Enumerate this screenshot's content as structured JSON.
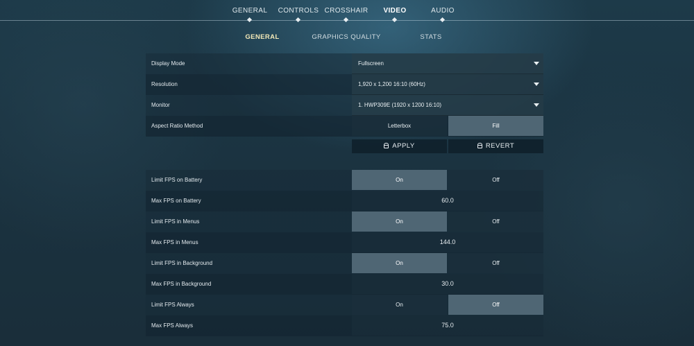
{
  "top_tabs": [
    {
      "label": "GENERAL",
      "active": false
    },
    {
      "label": "CONTROLS",
      "active": false
    },
    {
      "label": "CROSSHAIR",
      "active": false
    },
    {
      "label": "VIDEO",
      "active": true
    },
    {
      "label": "AUDIO",
      "active": false
    }
  ],
  "sub_tabs": [
    {
      "label": "GENERAL",
      "active": true
    },
    {
      "label": "GRAPHICS QUALITY",
      "active": false
    },
    {
      "label": "STATS",
      "active": false
    }
  ],
  "settings": {
    "display_mode": {
      "label": "Display Mode",
      "value": "Fullscreen"
    },
    "resolution": {
      "label": "Resolution",
      "value": "1,920 x 1,200 16:10 (60Hz)"
    },
    "monitor": {
      "label": "Monitor",
      "value": "1. HWP309E (1920 x  1200 16:10)"
    },
    "aspect_ratio": {
      "label": "Aspect Ratio Method",
      "options": [
        "Letterbox",
        "Fill"
      ],
      "selected": "Fill"
    }
  },
  "actions": {
    "apply_label": "APPLY",
    "revert_label": "REVERT"
  },
  "fps": {
    "limit_battery": {
      "label": "Limit FPS on Battery",
      "options": [
        "On",
        "Off"
      ],
      "selected": "On"
    },
    "max_battery": {
      "label": "Max FPS on Battery",
      "value": "60.0"
    },
    "limit_menus": {
      "label": "Limit FPS in Menus",
      "options": [
        "On",
        "Off"
      ],
      "selected": "On"
    },
    "max_menus": {
      "label": "Max FPS in Menus",
      "value": "144.0"
    },
    "limit_background": {
      "label": "Limit FPS in Background",
      "options": [
        "On",
        "Off"
      ],
      "selected": "On"
    },
    "max_background": {
      "label": "Max FPS in Background",
      "value": "30.0"
    },
    "limit_always": {
      "label": "Limit FPS Always",
      "options": [
        "On",
        "Off"
      ],
      "selected": "Off"
    },
    "max_always": {
      "label": "Max FPS Always",
      "value": "75.0"
    }
  },
  "icons": {
    "lock": "lock-icon",
    "dropdown": "chevron-down-icon"
  }
}
